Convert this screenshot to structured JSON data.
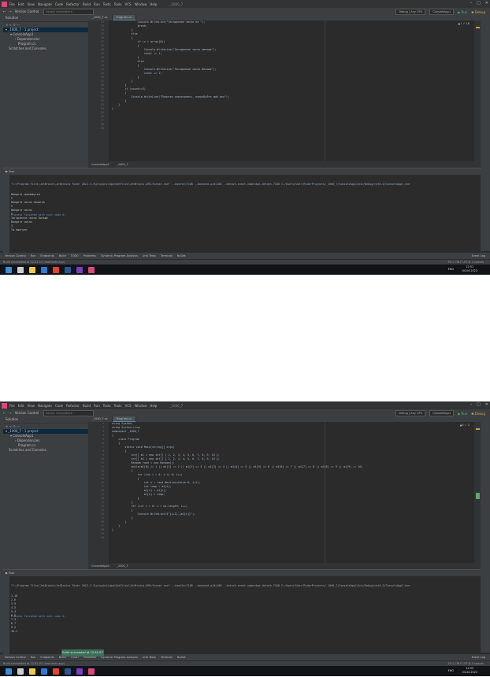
{
  "menu": [
    "File",
    "Edit",
    "View",
    "Navigate",
    "Code",
    "Refactor",
    "Build",
    "Run",
    "Tests",
    "Tools",
    "VCS",
    "Window",
    "Help"
  ],
  "window_title": "_1000_7",
  "toolbar": {
    "version_control": "Version Control",
    "search_placeholder": "Search everywhere",
    "config": "Debug | Any CPU",
    "project": "ConsoleApp1",
    "run": "Run",
    "debug": "Debug"
  },
  "solution": {
    "title": "Solution",
    "root": "_1000_7 · 1 project",
    "project": "ConsoleApp1",
    "deps": "Dependencies",
    "file": "Program.cs",
    "scratches": "Scratches and Consoles"
  },
  "shot1": {
    "tabs": [
      "_1000_7.cs",
      "Program.cs"
    ],
    "inspect": "▲1 ✓ 16",
    "line_numbers": [
      "32",
      "33",
      "34",
      "35",
      "36",
      "37",
      "38",
      "39",
      "40",
      "41",
      "42",
      "43",
      "44",
      "45",
      "46",
      "47",
      "48",
      "49",
      "50",
      "51",
      "52",
      "53",
      "54",
      "55",
      "56",
      "57",
      "58",
      "59"
    ],
    "code": [
      "                Console.WriteLine(\"Загаданное число не \");",
      "                break;",
      "            }",
      "            else",
      "            {",
      "                if (x > array[0])",
      "                {",
      "                    Console.WriteLine(\"Загаданное число меньше\");",
      "                    count += 1;",
      "                }",
      "                else",
      "                {",
      "                    Console.WriteLine(\"Загаданное число больше\");",
      "                    count += 1;",
      "                }",
      "            }",
      "        }",
      "        if (count>=5)",
      "        {",
      "            Console.WriteLine(\"Попытки закончились, попробуйте ещё раз\");",
      "        }",
      "    }",
      "}",
      "",
      "",
      "",
      "",
      ""
    ],
    "breadcrumb": [
      "ConsoleApp1",
      "_1000_7"
    ],
    "run_title": "Run",
    "command": "\"C:\\Program Files\\JetBrains\\JetBrains Rider 2022.3.3\\plugins\\dpa\\DotFiles\\JetBrains.DPA.Runner.exe\" --handle=7108 --backend-pid=280 --detach-event-name=dpa.detach.7108 C:/Users/User/RiderProjects/_1000_7/ConsoleApp1/bin/Debug/net6.0/ConsoleApp1.exe",
    "console": [
      "Введите промежутки",
      "5",
      "Введите число попыток",
      "5",
      "Введите число",
      "5",
      "Загаданное число больше",
      "Введите число",
      "3",
      "Ты выиграл"
    ],
    "finished": "Process finished with exit code 0.",
    "status_left": "Build succeeded at 12:51:17 (moments ago)",
    "status_right": "39:1  CRLF  UTF-8  4 spaces",
    "clock": [
      "12:51",
      "04.04.2023"
    ]
  },
  "shot2": {
    "tabs": [
      "_1000_7.cs",
      "Program.cs"
    ],
    "inspect": "▲5 ✓ 2",
    "line_numbers": [
      "1",
      "2",
      "3",
      "4",
      "5",
      "6",
      "7",
      "8",
      "9",
      "10",
      "11",
      "12",
      "13",
      "14",
      "15",
      "16",
      "17",
      "18",
      "19",
      "20",
      "21",
      "22",
      "23",
      "24",
      "25",
      "26",
      "27",
      "28",
      "29",
      "30"
    ],
    "code": [
      "using System;",
      "using System.Linq;",
      "namespace _1000_7",
      "{",
      "    class Program",
      "    {",
      "        static void Main(string[] args)",
      "        {",
      "            int[] m1 = new int[] { 1, 2, 3, 4, 5, 6, 7, 8, 9, 10 };",
      "            int[] m2 = new int[] { 1, 2, 3, 4, 5, 6, 7, 8, 9, 10 };",
      "            Random rand = new Random();",
      "            while(m1[0] == 1 || m1[1] == 2 || m1[2] == 3 || m1[3] == 4 || m1[4] == 5 || m1[5] == 6 || m1[6] == 7 || m1[7] == 8 || m1[8] == 9 || m1[9] == 10)",
      "            {",
      "                for (int i = 0; i <= 9; i++)",
      "                {",
      "                    int n = rand.Next(minValue:0, i+1);",
      "                    int temp = m1[i];",
      "                    m1[i] = m1[n];",
      "                    m1[n] = temp;",
      "                }",
      "            }",
      "            for (int i = 0; i < m1.Length; i++)",
      "            {",
      "                Console.WriteLine($\"{i+1}-{m1[i]}\");",
      "            }",
      "        }",
      "    }",
      "}",
      "",
      ""
    ],
    "breadcrumb": [
      "ConsoleApp1",
      "_1000_7"
    ],
    "run_title": "Run",
    "command": "\"C:\\Program Files\\JetBrains\\JetBrains Rider 2022.3.3\\plugins\\dpa\\DotFiles\\JetBrains.DPA.Runner.exe\" --handle=7108 --backend-pid=280 --detach-event-name=dpa.detach.7108 C:/Users/User/RiderProjects/_1000_7/ConsoleApp1/bin/Debug/net6.0/ConsoleApp1.exe",
    "console": [
      "1-10",
      "2-6",
      "3-9",
      "4-5",
      "5-4",
      "6-8",
      "7-3",
      "8-7",
      "9-2",
      "10-1"
    ],
    "finished": "Process finished with exit code 0.",
    "notification": "Build succeeded at 12:51:07",
    "status_left": "Build succeeded at 12:51:07 (moments ago)",
    "status_right": "29:1  CRLF  UTF-8  4 spaces",
    "clock": [
      "12:52",
      "04.04.2023"
    ]
  },
  "bottom_tabs": [
    "Version Control",
    "Run",
    "Endpoints",
    "Build",
    "TODO",
    "Problems",
    "Dynamic Program Analysis",
    "Unit Tests",
    "Terminal",
    "NuGet"
  ],
  "event_log": "Event Log",
  "lang": "ENG",
  "colors": {
    "editor_bg": "#2b2b2b",
    "panel_bg": "#3c3f41",
    "keyword": "#cc7832",
    "string": "#6a8759",
    "accent": "#4a88c7"
  }
}
